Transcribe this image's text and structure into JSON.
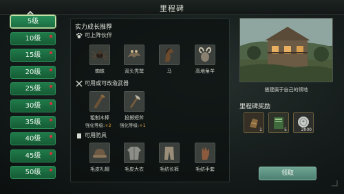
{
  "header": {
    "title": "里程碑"
  },
  "levels": [
    "5级",
    "10级",
    "15级",
    "20级",
    "25级",
    "30级",
    "35级",
    "40级",
    "45级",
    "50级"
  ],
  "active_level_index": 0,
  "panel": {
    "title": "实力成长推荐",
    "partners": {
      "heading": "可上阵伙伴",
      "items": [
        {
          "name": "蜘蛛",
          "icon": "spider-icon"
        },
        {
          "name": "双头秃鹫",
          "icon": "vulture-icon"
        },
        {
          "name": "马",
          "icon": "horse-icon"
        },
        {
          "name": "高地角羊",
          "icon": "ram-icon"
        }
      ]
    },
    "weapons": {
      "heading": "可用或可改造武器",
      "items": [
        {
          "name": "粗制木棒",
          "stat_label": "强化等级:",
          "stat_value": "+2",
          "icon": "club-icon"
        },
        {
          "name": "投掷短斧",
          "stat_label": "强化等级:",
          "stat_value": "+1",
          "icon": "axe-icon"
        }
      ]
    },
    "armor": {
      "heading": "可用防具",
      "items": [
        {
          "name": "毛皮礼帽",
          "icon": "hat-icon"
        },
        {
          "name": "毛皮大衣",
          "icon": "coat-icon"
        },
        {
          "name": "毛纺长裤",
          "icon": "pants-icon"
        },
        {
          "name": "毛纺手套",
          "icon": "gloves-icon"
        }
      ]
    }
  },
  "preview": {
    "caption": "搭建属于自己的领地"
  },
  "rewards": {
    "title": "里程碑奖励",
    "items": [
      {
        "count": "1",
        "icon": "blueprint-item-icon"
      },
      {
        "count": "5",
        "icon": "book-icon"
      },
      {
        "count": "2000",
        "icon": "silver-coin-icon"
      }
    ]
  },
  "claim_label": "领取",
  "colors": {
    "level_button": "#1f7a49",
    "claim_button": "#5e9382",
    "accent_plus": "#e2a13a",
    "badge_dot": "#d5333d"
  }
}
